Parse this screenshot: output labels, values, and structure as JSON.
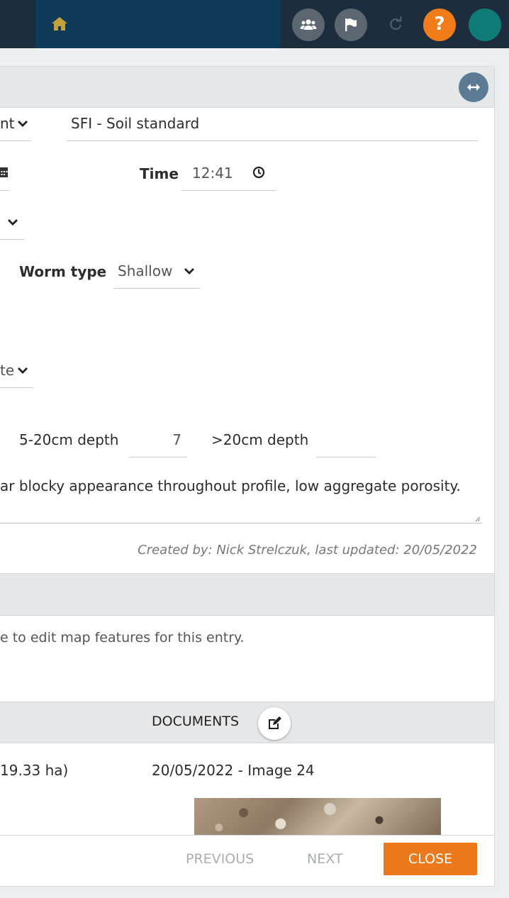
{
  "topbar": {
    "icons": [
      "home-icon",
      "users-icon",
      "flag-icon",
      "refresh-icon",
      "help-icon",
      "avatar"
    ],
    "help_label": "?",
    "colors": {
      "bar": "#1d2d3e",
      "home_box": "#0f3b58",
      "help": "#f07d1a",
      "avatar": "#0e7b76"
    }
  },
  "form": {
    "type_select": {
      "value_partial": "nt"
    },
    "template": {
      "value": "SFI - Soil standard"
    },
    "time": {
      "label": "Time",
      "value": "12:41"
    },
    "worm_type": {
      "label": "Worm type",
      "value": "Shallow"
    },
    "select_partial": {
      "value_partial": "te"
    },
    "depth": {
      "mid_label": "5-20cm depth",
      "mid_value": "7",
      "deep_label": ">20cm depth",
      "deep_value": ""
    },
    "notes": "ar blocky appearance throughout profile, low aggregate porosity.",
    "meta": "Created by: Nick Strelczuk, last updated: 20/05/2022"
  },
  "map": {
    "message": "e to edit map features for this entry."
  },
  "documents": {
    "title": "DOCUMENTS",
    "area_partial": "19.33 ha)",
    "item_label": "20/05/2022 - Image 24"
  },
  "footer": {
    "previous_label": "PREVIOUS",
    "next_label": "NEXT",
    "close_label": "CLOSE",
    "close_color": "#ec7a1c"
  }
}
